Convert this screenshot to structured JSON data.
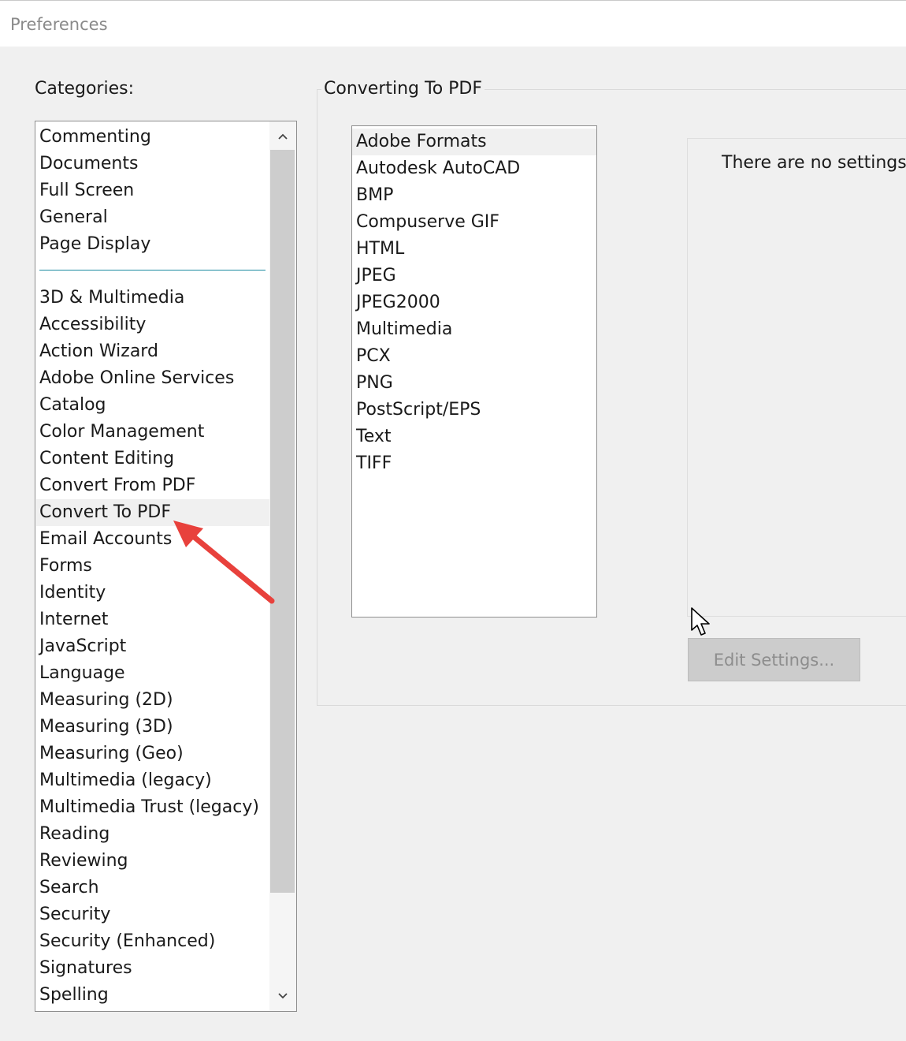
{
  "window": {
    "title": "Preferences"
  },
  "categories": {
    "label": "Categories:",
    "top_items": [
      "Commenting",
      "Documents",
      "Full Screen",
      "General",
      "Page Display"
    ],
    "items": [
      "3D & Multimedia",
      "Accessibility",
      "Action Wizard",
      "Adobe Online Services",
      "Catalog",
      "Color Management",
      "Content Editing",
      "Convert From PDF",
      "Convert To PDF",
      "Email Accounts",
      "Forms",
      "Identity",
      "Internet",
      "JavaScript",
      "Language",
      "Measuring (2D)",
      "Measuring (3D)",
      "Measuring (Geo)",
      "Multimedia (legacy)",
      "Multimedia Trust (legacy)",
      "Reading",
      "Reviewing",
      "Search",
      "Security",
      "Security (Enhanced)",
      "Signatures",
      "Spelling"
    ],
    "selected": "Convert To PDF"
  },
  "converting": {
    "group_title": "Converting To PDF",
    "formats": [
      "Adobe Formats",
      "Autodesk AutoCAD",
      "BMP",
      "Compuserve GIF",
      "HTML",
      "JPEG",
      "JPEG2000",
      "Multimedia",
      "PCX",
      "PNG",
      "PostScript/EPS",
      "Text",
      "TIFF"
    ],
    "selected_format": "Adobe Formats",
    "settings_message": "There are no settings f",
    "edit_button_label": "Edit Settings...",
    "edit_button_enabled": false
  },
  "colors": {
    "accent_separator": "#1b8aa0",
    "annotation_arrow": "#e8413c"
  },
  "icons": {
    "scroll_up": "chevron-up-icon",
    "scroll_down": "chevron-down-icon",
    "cursor": "mouse-pointer-icon",
    "annotation": "red-arrow-icon"
  }
}
